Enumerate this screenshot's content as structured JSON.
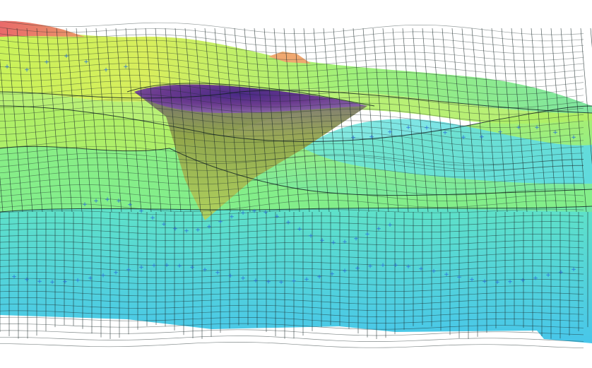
{
  "figure": {
    "kind": "3d-geological-surface-mesh",
    "view": "oblique-perspective",
    "colormap": {
      "name": "elevation-rainbow",
      "stops": [
        "#39b8e8",
        "#3fe3d6",
        "#7ff28a",
        "#c9f25a",
        "#e6e85a",
        "#f2a84a",
        "#e3616e",
        "#5a2f8a"
      ]
    },
    "layers": [
      {
        "name": "upper-surface",
        "color": "#b8f06a"
      },
      {
        "name": "middle-surface",
        "color": "#7feaa0"
      },
      {
        "name": "lower-block",
        "color": "#56d9e6"
      },
      {
        "name": "cone-body",
        "color": "#9fc43c"
      },
      {
        "name": "cone-lens",
        "color": "#5b3a93"
      }
    ],
    "marker_color": "#2a6fd6",
    "mesh_color": "#1b2a2a"
  }
}
